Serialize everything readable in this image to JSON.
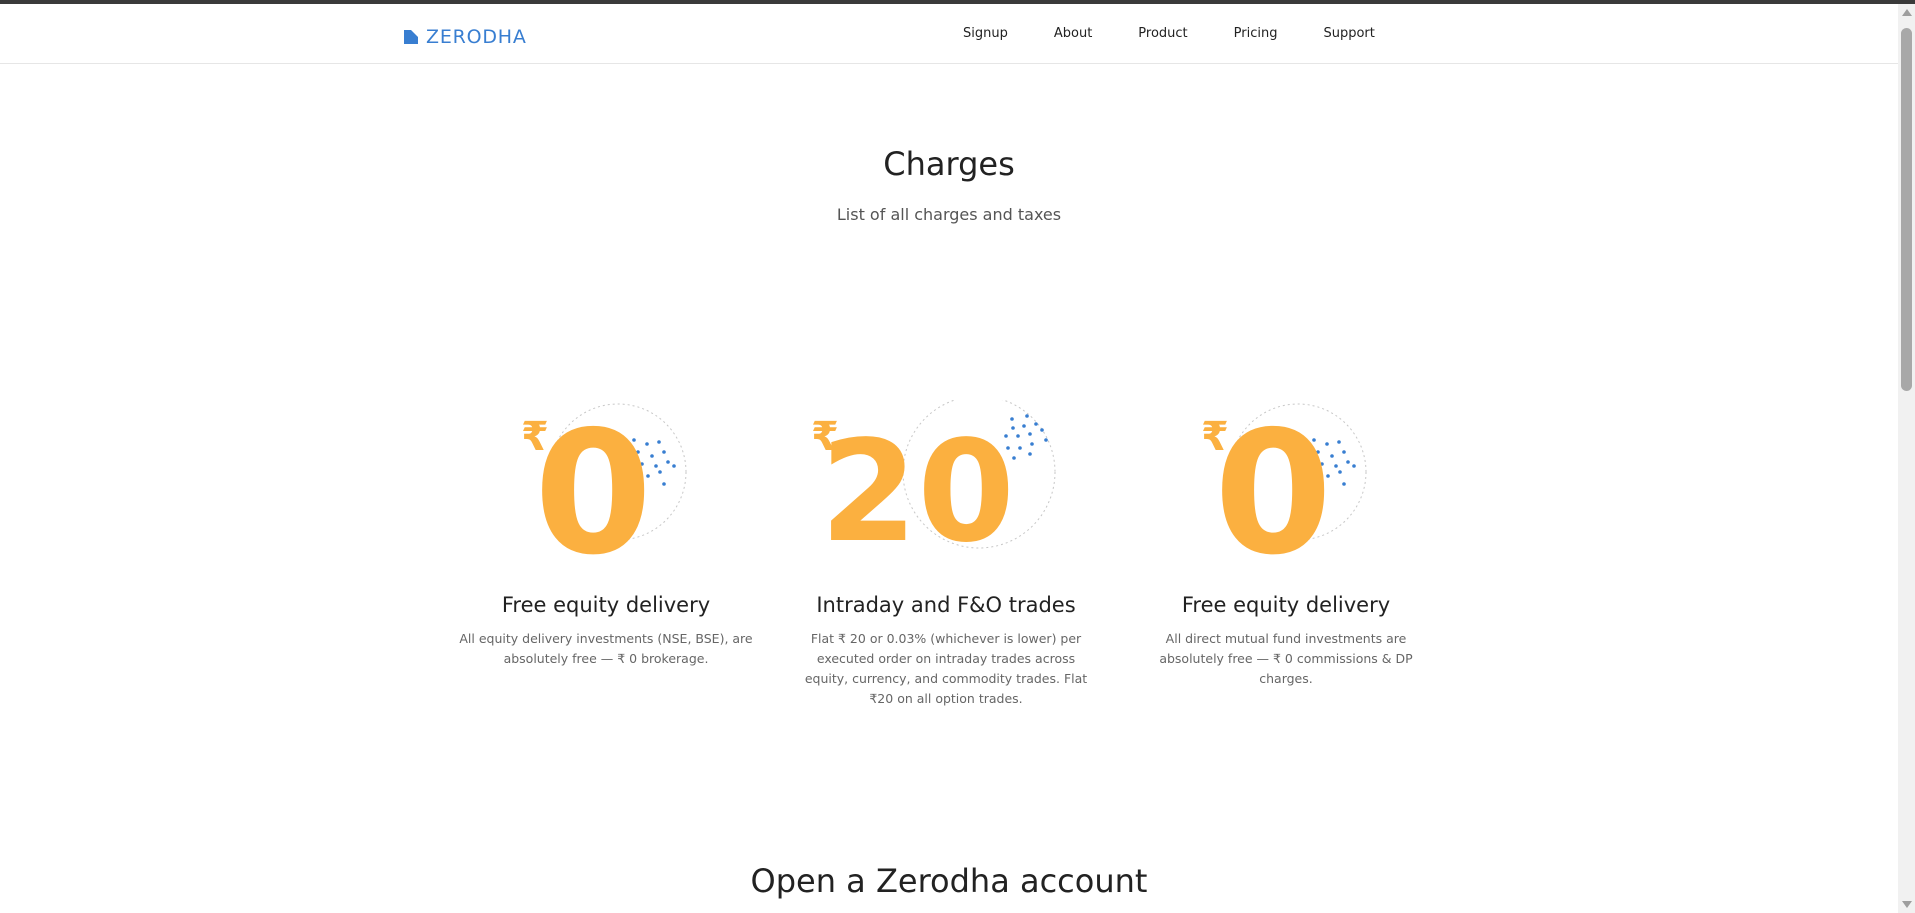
{
  "header": {
    "logo_text": "ZERODHA",
    "nav": [
      "Signup",
      "About",
      "Product",
      "Pricing",
      "Support"
    ]
  },
  "hero": {
    "title": "Charges",
    "subtitle": "List of all charges and taxes"
  },
  "cards": [
    {
      "currency": "₹",
      "amount": "0",
      "title": "Free equity delivery",
      "description": "All equity delivery investments (NSE, BSE), are absolutely free — ₹ 0 brokerage."
    },
    {
      "currency": "₹",
      "amount": "20",
      "title": "Intraday and F&O trades",
      "description": "Flat ₹ 20 or 0.03% (whichever is lower) per executed order on intraday trades across equity, currency, and commodity trades. Flat ₹20 on all option trades."
    },
    {
      "currency": "₹",
      "amount": "0",
      "title": "Free equity delivery",
      "description": "All direct mutual fund investments are absolutely free — ₹ 0 commissions & DP charges."
    }
  ],
  "cta": {
    "title": "Open a Zerodha account"
  },
  "colors": {
    "brand_blue": "#387ed1",
    "accent_orange": "#fbb040"
  },
  "icons": {
    "logo": "zerodha-logo-icon",
    "scroll_up": "chevron-up-icon",
    "scroll_down": "chevron-down-icon"
  }
}
